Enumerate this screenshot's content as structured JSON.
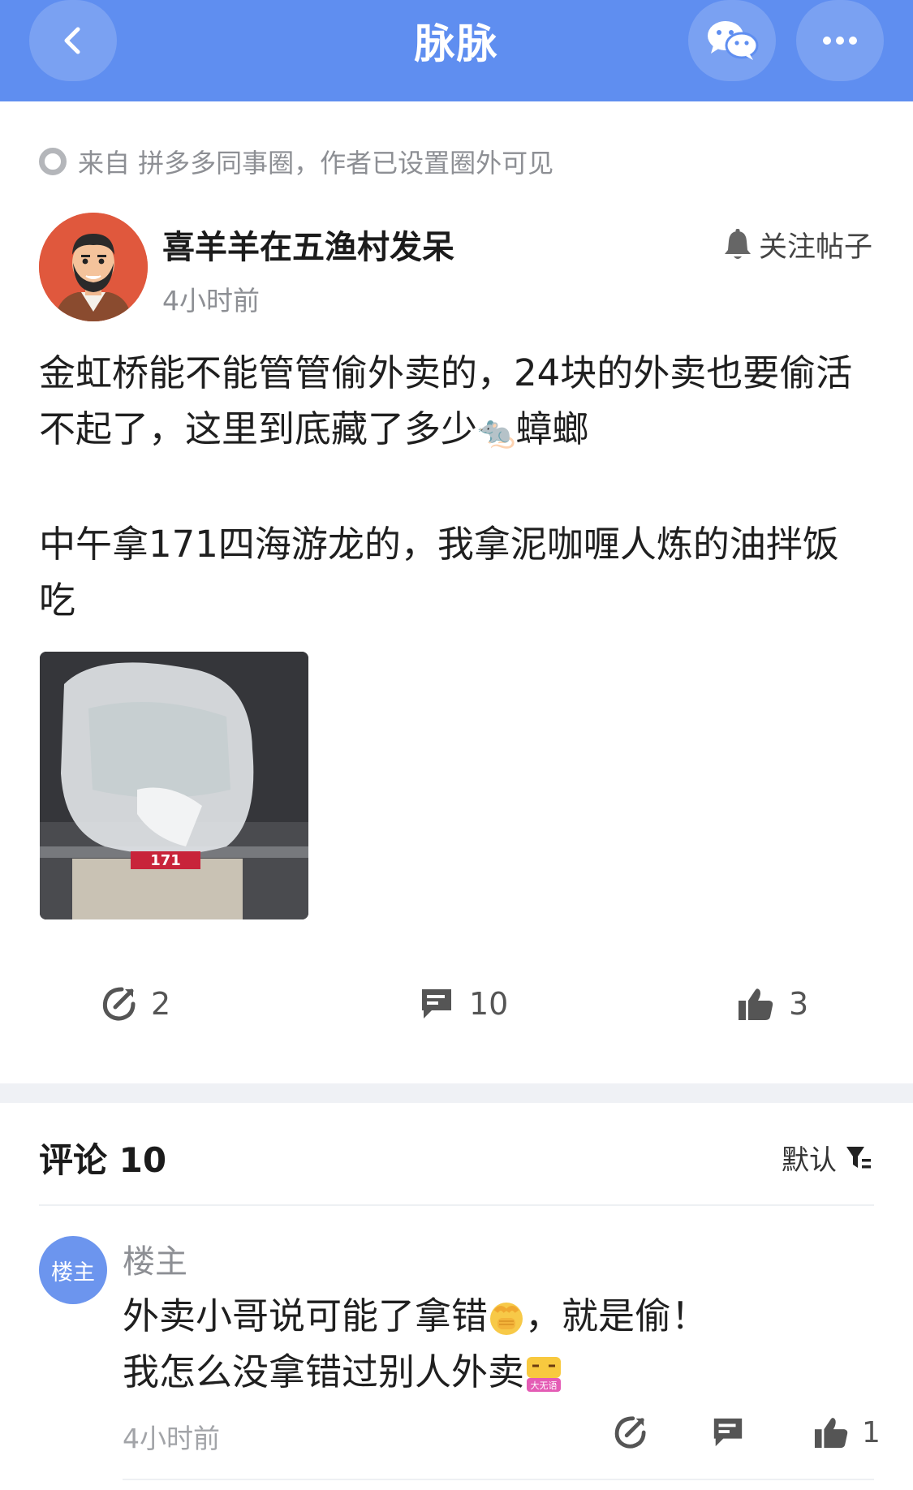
{
  "header": {
    "title": "脉脉",
    "back_icon": "chevron-left-icon",
    "share_icon": "wechat-icon",
    "more_icon": "more-horizontal-icon",
    "accent": "#5f8ef0"
  },
  "post": {
    "source_label": "来自 拼多多同事圈，作者已设置圈外可见",
    "author_name": "喜羊羊在五渔村发呆",
    "time": "4小时前",
    "follow_label": "关注帖子",
    "paragraph1_a": "金虹桥能不能管管偷外卖的，24块的外卖也要偷活不起了，这里到底藏了多少",
    "rat_emoji": "🐀",
    "paragraph1_b": "蟑螂",
    "paragraph2": "中午拿171四海游龙的，我拿泥咖喱人炼的油拌饭吃",
    "photo_label": "171",
    "repost_count": "2",
    "comment_count": "10",
    "like_count": "3"
  },
  "comments": {
    "title": "评论 10",
    "sort_label": "默认",
    "items": [
      {
        "avatar_label": "楼主",
        "author": "楼主",
        "line1_a": "外卖小哥说可能了拿错",
        "line1_b": "，就是偷！",
        "line2": "我怎么没拿错过别人外卖",
        "sticker_label": "大无语",
        "time": "4小时前",
        "like_count": "1"
      }
    ]
  }
}
